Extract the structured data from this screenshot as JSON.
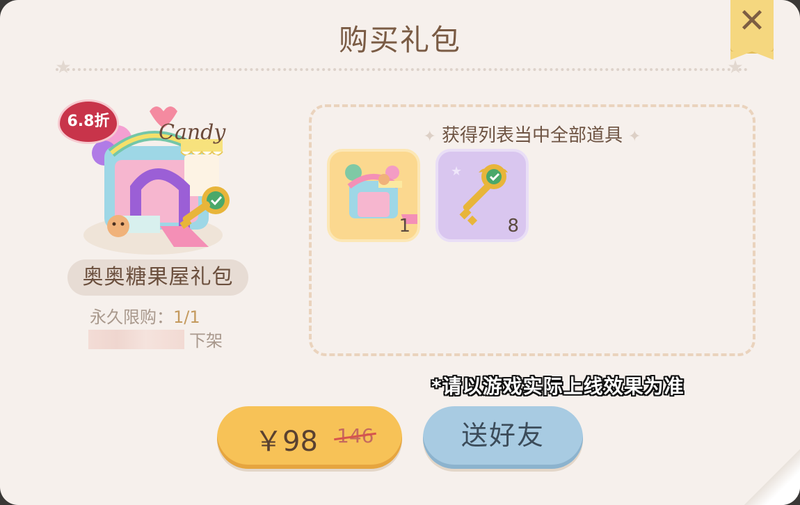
{
  "dialog": {
    "title": "购买礼包",
    "close_label": "✕"
  },
  "package": {
    "discount": "6.8折",
    "name": "奥奥糖果屋礼包",
    "limit_label": "永久限购：",
    "limit_value": "1/1",
    "offshelf_label": "下架"
  },
  "rewards": {
    "title": "获得列表当中全部道具",
    "items": [
      {
        "icon": "candy-house-icon",
        "count": "1"
      },
      {
        "icon": "golden-key-icon",
        "count": "8"
      }
    ]
  },
  "disclaimer": "*请以游戏实际上线效果为准",
  "buttons": {
    "price": "￥98",
    "original_price": "146",
    "gift_label": "送好友"
  },
  "colors": {
    "buy_button": "#f7c257",
    "gift_button": "#a8cbe2",
    "discount_badge": "#c8344a"
  }
}
